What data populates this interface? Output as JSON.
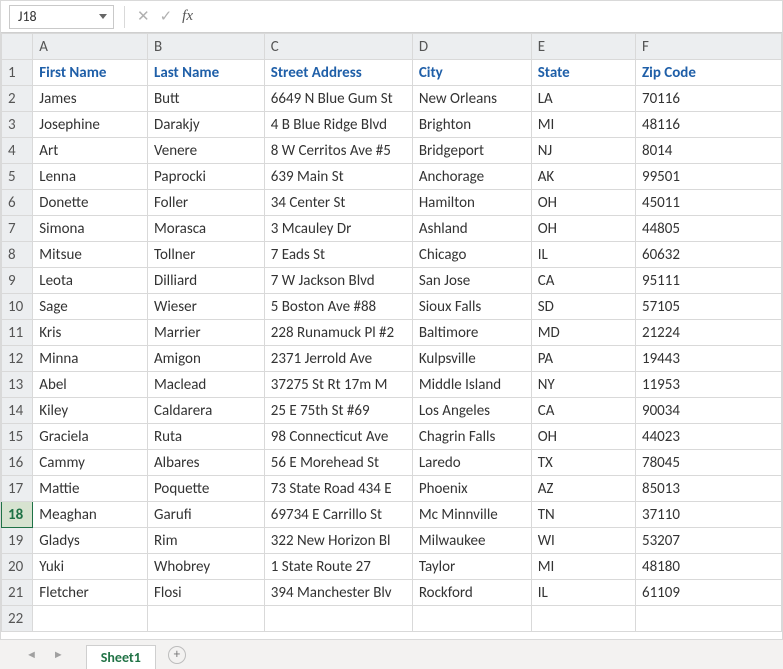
{
  "namebox": "J18",
  "formula": "",
  "selected_row": 18,
  "columns": [
    "A",
    "B",
    "C",
    "D",
    "E",
    "F"
  ],
  "header": [
    "First Name",
    "Last Name",
    "Street Address",
    "City",
    "State",
    "Zip Code"
  ],
  "rows": [
    [
      "James",
      "Butt",
      "6649 N Blue Gum St",
      "New Orleans",
      "LA",
      "70116"
    ],
    [
      "Josephine",
      "Darakjy",
      "4 B Blue Ridge Blvd",
      "Brighton",
      "MI",
      "48116"
    ],
    [
      "Art",
      "Venere",
      "8 W Cerritos Ave #5",
      "Bridgeport",
      "NJ",
      "8014"
    ],
    [
      "Lenna",
      "Paprocki",
      "639 Main St",
      "Anchorage",
      "AK",
      "99501"
    ],
    [
      "Donette",
      "Foller",
      "34 Center St",
      "Hamilton",
      "OH",
      "45011"
    ],
    [
      "Simona",
      "Morasca",
      "3 Mcauley Dr",
      "Ashland",
      "OH",
      "44805"
    ],
    [
      "Mitsue",
      "Tollner",
      "7 Eads St",
      "Chicago",
      "IL",
      "60632"
    ],
    [
      "Leota",
      "Dilliard",
      "7 W Jackson Blvd",
      "San Jose",
      "CA",
      "95111"
    ],
    [
      "Sage",
      "Wieser",
      "5 Boston Ave #88",
      "Sioux Falls",
      "SD",
      "57105"
    ],
    [
      "Kris",
      "Marrier",
      "228 Runamuck Pl #2",
      "Baltimore",
      "MD",
      "21224"
    ],
    [
      "Minna",
      "Amigon",
      "2371 Jerrold Ave",
      "Kulpsville",
      "PA",
      "19443"
    ],
    [
      "Abel",
      "Maclead",
      "37275 St  Rt 17m M",
      "Middle Island",
      "NY",
      "11953"
    ],
    [
      "Kiley",
      "Caldarera",
      "25 E 75th St #69",
      "Los Angeles",
      "CA",
      "90034"
    ],
    [
      "Graciela",
      "Ruta",
      "98 Connecticut Ave",
      "Chagrin Falls",
      "OH",
      "44023"
    ],
    [
      "Cammy",
      "Albares",
      "56 E Morehead St",
      "Laredo",
      "TX",
      "78045"
    ],
    [
      "Mattie",
      "Poquette",
      "73 State Road 434 E",
      "Phoenix",
      "AZ",
      "85013"
    ],
    [
      "Meaghan",
      "Garufi",
      "69734 E Carrillo St",
      "Mc Minnville",
      "TN",
      "37110"
    ],
    [
      "Gladys",
      "Rim",
      "322 New Horizon Bl",
      "Milwaukee",
      "WI",
      "53207"
    ],
    [
      "Yuki",
      "Whobrey",
      "1 State Route 27",
      "Taylor",
      "MI",
      "48180"
    ],
    [
      "Fletcher",
      "Flosi",
      "394 Manchester Blv",
      "Rockford",
      "IL",
      "61109"
    ]
  ],
  "sheet_tab": "Sheet1",
  "nav_prev": "◄",
  "nav_next": "►",
  "add_label": "+"
}
